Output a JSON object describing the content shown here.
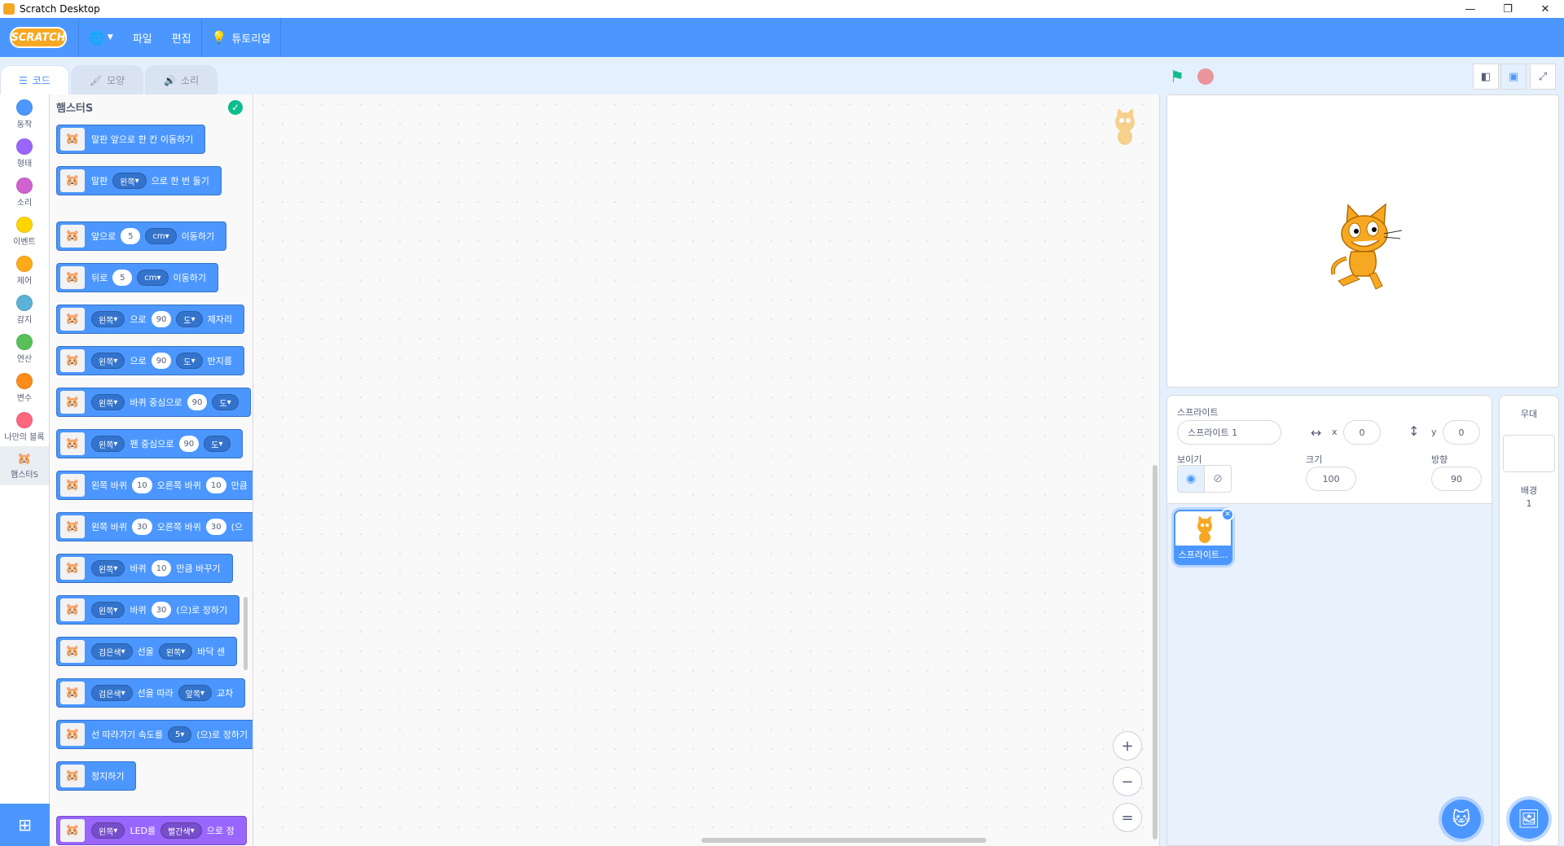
{
  "window": {
    "title": "Scratch Desktop",
    "minimize": "—",
    "restore": "❐",
    "close": "✕"
  },
  "menubar": {
    "logo": "SCRATCH",
    "language_icon": "🌐",
    "file": "파일",
    "edit": "편집",
    "tutorials": "튜토리얼"
  },
  "tabs": {
    "code": "코드",
    "costumes": "모양",
    "sounds": "소리"
  },
  "categories": [
    {
      "label": "동작",
      "color": "#4c97ff"
    },
    {
      "label": "형태",
      "color": "#9966ff"
    },
    {
      "label": "소리",
      "color": "#cf63cf"
    },
    {
      "label": "이벤트",
      "color": "#ffd500"
    },
    {
      "label": "제어",
      "color": "#ffab19"
    },
    {
      "label": "감지",
      "color": "#5cb1d6"
    },
    {
      "label": "연산",
      "color": "#59c059"
    },
    {
      "label": "변수",
      "color": "#ff8c1a"
    },
    {
      "label": "나만의 블록",
      "color": "#ff6680"
    },
    {
      "label": "햄스터S",
      "color": ""
    }
  ],
  "palette": {
    "title": "햄스터S",
    "blocks": {
      "b1": {
        "t1": "말판 앞으로 한 칸 이동하기"
      },
      "b2": {
        "t1": "말판",
        "d1": "왼쪽",
        "t2": "으로 한 번 돌기"
      },
      "b3": {
        "t1": "앞으로",
        "n1": "5",
        "d1": "cm",
        "t2": "이동하기"
      },
      "b4": {
        "t1": "뒤로",
        "n1": "5",
        "d1": "cm",
        "t2": "이동하기"
      },
      "b5": {
        "d1": "왼쪽",
        "t1": "으로",
        "n1": "90",
        "d2": "도",
        "t2": "제자리"
      },
      "b6": {
        "d1": "왼쪽",
        "t1": "으로",
        "n1": "90",
        "d2": "도",
        "t2": "반지름"
      },
      "b7": {
        "d1": "왼쪽",
        "t1": "바퀴 중심으로",
        "n1": "90",
        "d2": "도"
      },
      "b8": {
        "d1": "왼쪽",
        "t1": "펜 중심으로",
        "n1": "90",
        "d2": "도"
      },
      "b9": {
        "t1": "왼쪽 바퀴",
        "n1": "10",
        "t2": "오른쪽 바퀴",
        "n2": "10",
        "t3": "만큼"
      },
      "b10": {
        "t1": "왼쪽 바퀴",
        "n1": "30",
        "t2": "오른쪽 바퀴",
        "n2": "30",
        "t3": "(으"
      },
      "b11": {
        "d1": "왼쪽",
        "t1": "바퀴",
        "n1": "10",
        "t2": "만큼 바꾸기"
      },
      "b12": {
        "d1": "왼쪽",
        "t1": "바퀴",
        "n1": "30",
        "t2": "(으)로 정하기"
      },
      "b13": {
        "d1": "검은색",
        "t1": "선을",
        "d2": "왼쪽",
        "t2": "바닥 센"
      },
      "b14": {
        "d1": "검은색",
        "t1": "선을 따라",
        "d2": "앞쪽",
        "t2": "교차"
      },
      "b15": {
        "t1": "선 따라가기 속도를",
        "d1": "5",
        "t2": "(으)로 정하기"
      },
      "b16": {
        "t1": "정지하기"
      },
      "b17": {
        "d1": "왼쪽",
        "t1": "LED를",
        "d2": "빨간색",
        "t2": "으로 정"
      }
    }
  },
  "workspace": {
    "zoom_in": "+",
    "zoom_out": "−",
    "zoom_reset": "="
  },
  "sprite_info": {
    "sprite_label": "스프라이트",
    "sprite_name": "스프라이트 1",
    "x_label": "x",
    "x_value": "0",
    "y_label": "y",
    "y_value": "0",
    "show_label": "보이기",
    "size_label": "크기",
    "size_value": "100",
    "direction_label": "방향",
    "direction_value": "90"
  },
  "sprite_list": [
    {
      "name": "스프라이트..."
    }
  ],
  "stage_panel": {
    "title": "무대",
    "backdrops_label": "배경",
    "backdrops_count": "1"
  }
}
